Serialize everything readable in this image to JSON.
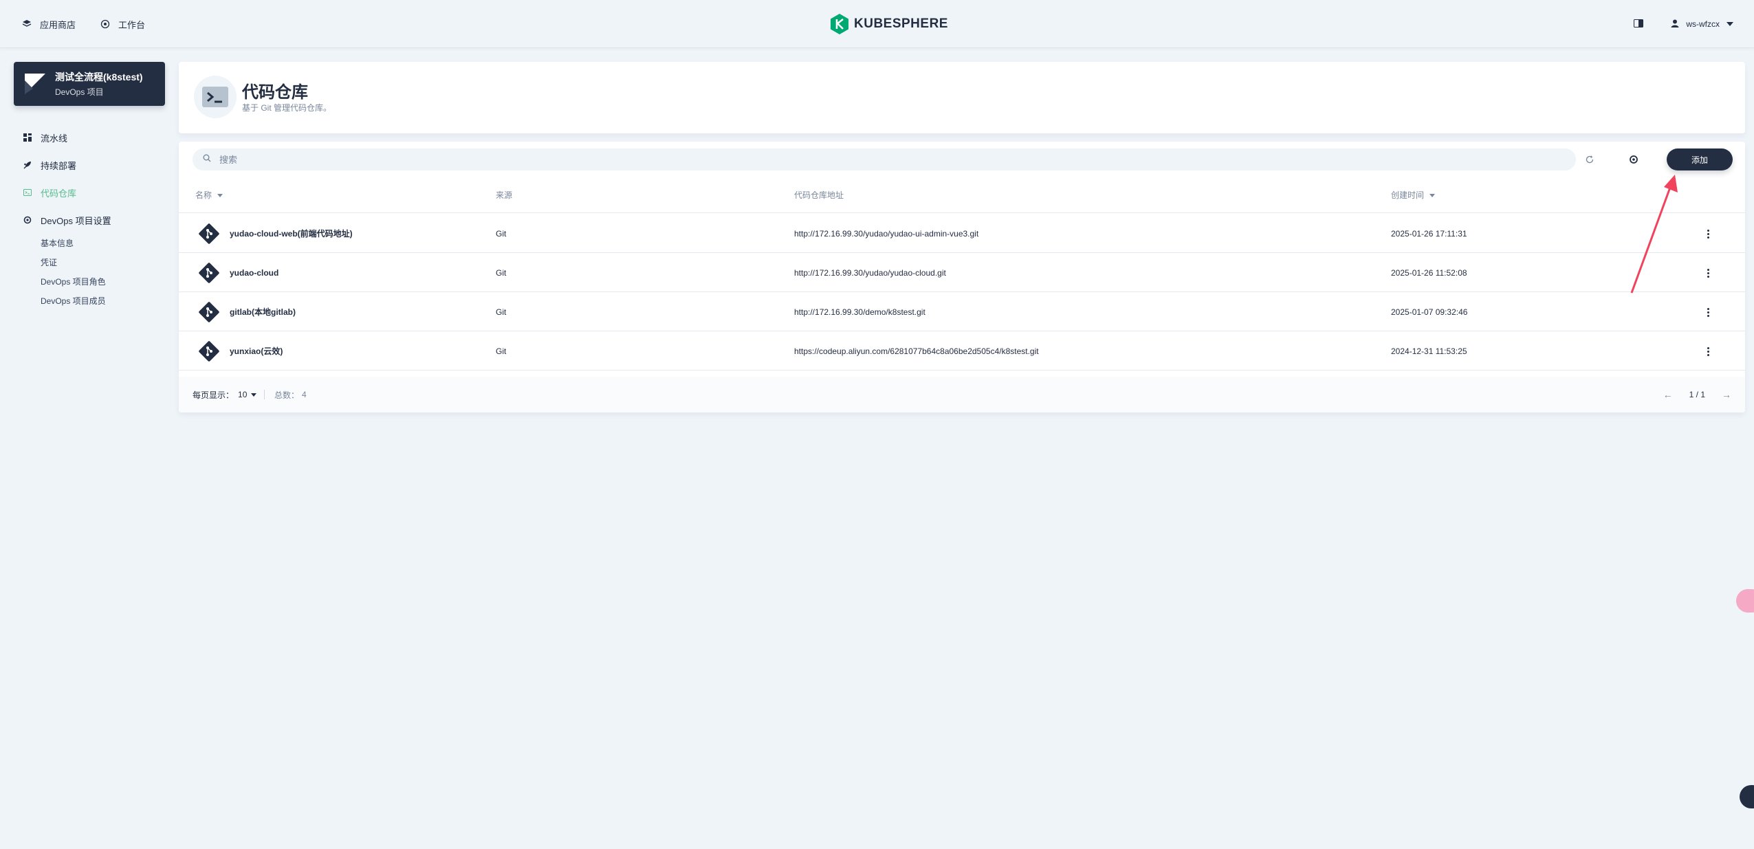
{
  "topbar": {
    "nav": [
      {
        "label": "应用商店",
        "icon": "app-store-icon"
      },
      {
        "label": "工作台",
        "icon": "workbench-icon"
      }
    ],
    "logo_text": "KUBESPHERE",
    "user": "ws-wfzcx"
  },
  "project": {
    "title": "测试全流程(k8stest)",
    "subtitle": "DevOps 项目"
  },
  "sidebar": {
    "items": [
      {
        "label": "流水线",
        "icon": "pipeline-icon"
      },
      {
        "label": "持续部署",
        "icon": "rocket-icon"
      },
      {
        "label": "代码仓库",
        "icon": "code-repo-icon",
        "active": true
      },
      {
        "label": "DevOps 项目设置",
        "icon": "gear-icon"
      }
    ],
    "sub_items": [
      "基本信息",
      "凭证",
      "DevOps 项目角色",
      "DevOps 项目成员"
    ]
  },
  "page": {
    "title": "代码仓库",
    "description": "基于 Git 管理代码仓库。"
  },
  "toolbar": {
    "search_placeholder": "搜索",
    "add_label": "添加"
  },
  "table": {
    "columns": [
      "名称",
      "来源",
      "代码仓库地址",
      "创建时间"
    ],
    "rows": [
      {
        "name": "yudao-cloud-web(前端代码地址)",
        "source": "Git",
        "url": "http://172.16.99.30/yudao/yudao-ui-admin-vue3.git",
        "created": "2025-01-26 17:11:31"
      },
      {
        "name": "yudao-cloud",
        "source": "Git",
        "url": "http://172.16.99.30/yudao/yudao-cloud.git",
        "created": "2025-01-26 11:52:08"
      },
      {
        "name": "gitlab(本地gitlab)",
        "source": "Git",
        "url": "http://172.16.99.30/demo/k8stest.git",
        "created": "2025-01-07 09:32:46"
      },
      {
        "name": "yunxiao(云效)",
        "source": "Git",
        "url": "https://codeup.aliyun.com/6281077b64c8a06be2d505c4/k8stest.git",
        "created": "2024-12-31 11:53:25"
      }
    ]
  },
  "footer": {
    "per_page_label": "每页显示：",
    "per_page_value": "10",
    "total_label": "总数：",
    "total_value": "4",
    "page_indicator": "1 / 1",
    "prev": "←",
    "next": "→"
  },
  "colors": {
    "primary_dark": "#242e42",
    "active_green": "#55bc8a",
    "background": "#eff4f9",
    "annotation_red": "#f0445c"
  }
}
